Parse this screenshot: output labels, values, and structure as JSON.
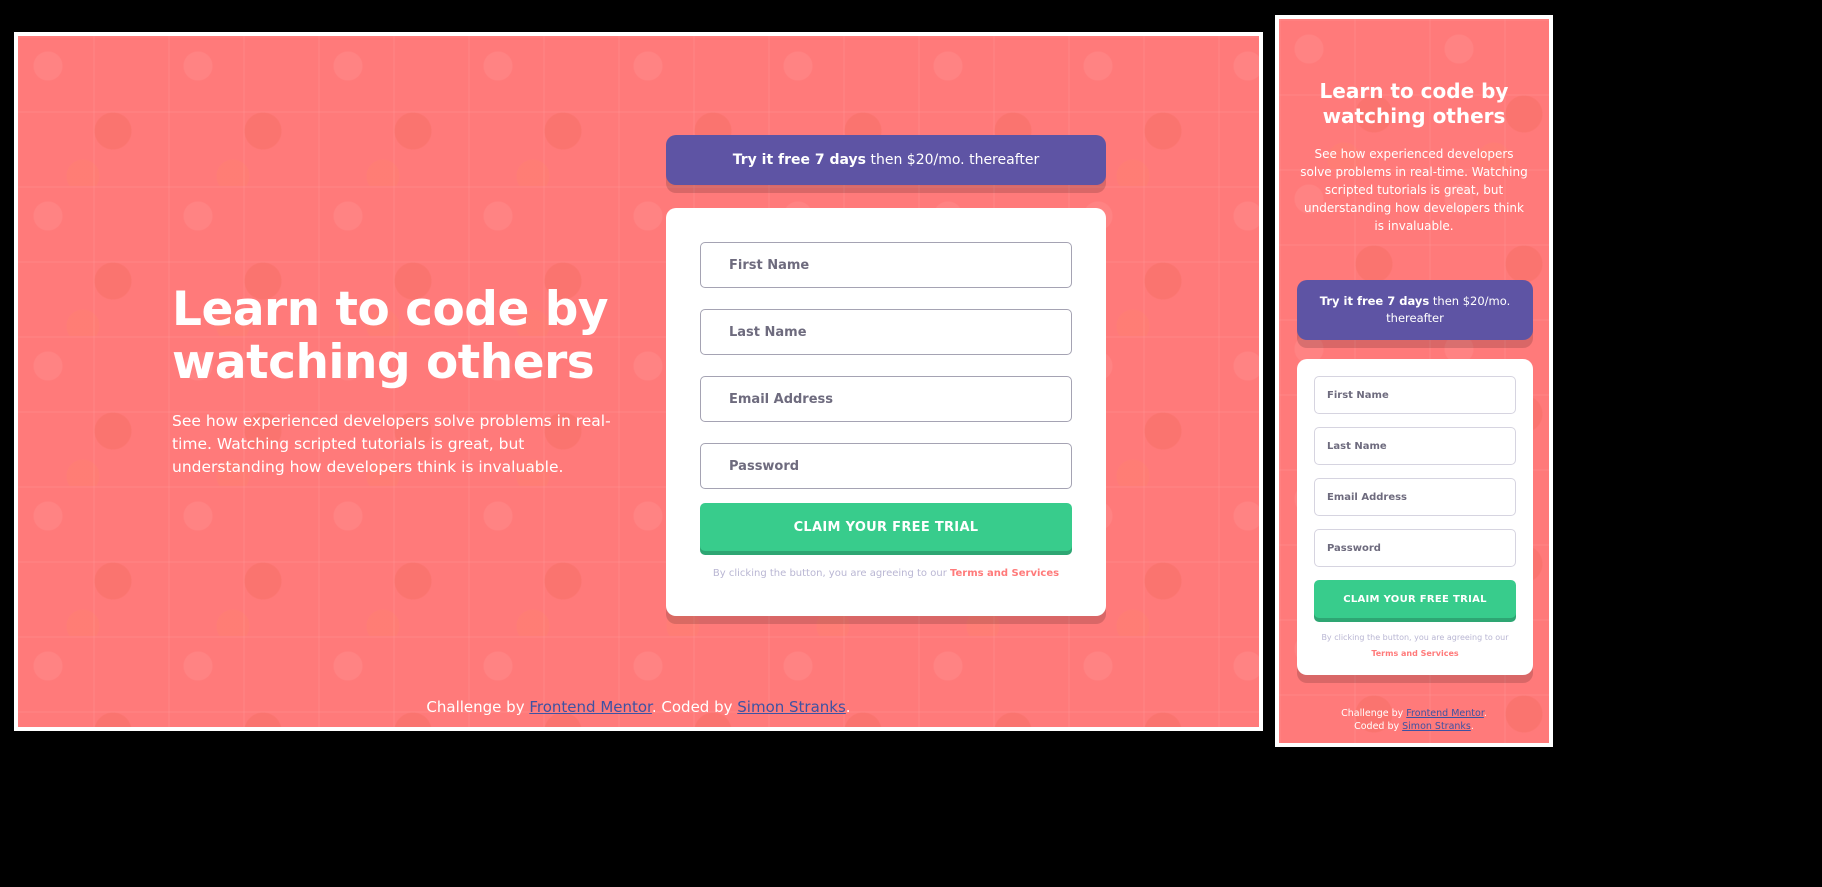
{
  "colors": {
    "background": "#ff7a7a",
    "banner": "#5e54a4",
    "cta": "#38cc8c",
    "accent_link": "#ff7a7a",
    "attribution_link": "#3e52a3"
  },
  "hero": {
    "title": "Learn to code by watching others",
    "description": "See how experienced developers solve problems in real-time. Watching scripted tutorials is great, but understanding how developers think is invaluable."
  },
  "banner": {
    "bold": "Try it free 7 days",
    "rest": " then $20/mo. thereafter"
  },
  "form": {
    "first_name_placeholder": "First Name",
    "last_name_placeholder": "Last Name",
    "email_placeholder": "Email Address",
    "password_placeholder": "Password",
    "submit_label": "CLAIM YOUR FREE TRIAL",
    "terms_prefix": "By clicking the button, you are agreeing to our ",
    "terms_link": "Terms and Services"
  },
  "attribution": {
    "challenge_prefix": "Challenge by ",
    "challenge_link": "Frontend Mentor",
    "coded_prefix": ". Coded by ",
    "coded_prefix_mobile": "Coded by ",
    "coded_link": "Simon Stranks",
    "suffix": "."
  }
}
